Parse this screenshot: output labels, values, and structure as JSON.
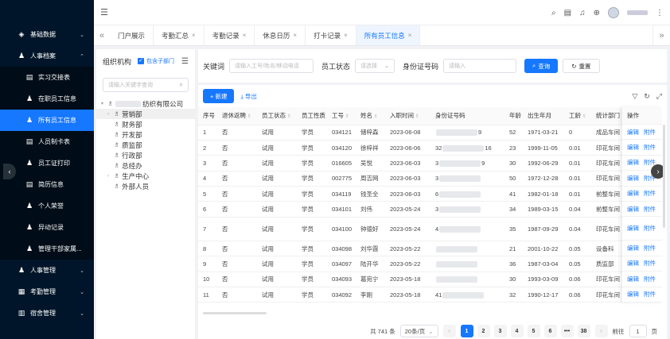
{
  "sidebar": {
    "items": [
      {
        "label": "基础数据",
        "icon": "layers-icon",
        "type": "group"
      },
      {
        "label": "人事档案",
        "icon": "user-icon",
        "type": "group-open"
      },
      {
        "label": "实习交接表",
        "icon": "doc-icon",
        "type": "sub"
      },
      {
        "label": "在职员工信息",
        "icon": "user-icon",
        "type": "sub"
      },
      {
        "label": "所有员工信息",
        "icon": "user-icon",
        "type": "sub-active"
      },
      {
        "label": "人员制卡表",
        "icon": "doc-icon",
        "type": "sub"
      },
      {
        "label": "员工证打印",
        "icon": "user-icon",
        "type": "sub"
      },
      {
        "label": "简历信息",
        "icon": "doc-icon",
        "type": "sub"
      },
      {
        "label": "个人荣誉",
        "icon": "user-icon",
        "type": "sub"
      },
      {
        "label": "异动记录",
        "icon": "user-icon",
        "type": "sub"
      },
      {
        "label": "管理干部家属...",
        "icon": "user-icon",
        "type": "sub"
      },
      {
        "label": "人事管理",
        "icon": "user-icon",
        "type": "group"
      },
      {
        "label": "考勤管理",
        "icon": "calendar-icon",
        "type": "group"
      },
      {
        "label": "宿舍管理",
        "icon": "building-icon",
        "type": "group"
      }
    ]
  },
  "tabs": [
    {
      "label": "门户展示",
      "close": false,
      "active": false
    },
    {
      "label": "考勤汇总",
      "close": true,
      "active": false
    },
    {
      "label": "考勤记录",
      "close": true,
      "active": false
    },
    {
      "label": "休息日历",
      "close": true,
      "active": false
    },
    {
      "label": "打卡记录",
      "close": true,
      "active": false
    },
    {
      "label": "所有员工信息",
      "close": true,
      "active": true
    }
  ],
  "org": {
    "title": "组织机构",
    "include_sub": "包含子部门",
    "search_placeholder": "请输入关键字查询",
    "root_suffix": "纺织有限公司",
    "nodes": [
      {
        "label": "营销部",
        "arrow": true,
        "selected": true
      },
      {
        "label": "财务部",
        "arrow": false
      },
      {
        "label": "开发部",
        "arrow": false
      },
      {
        "label": "质监部",
        "arrow": false
      },
      {
        "label": "行政部",
        "arrow": false
      },
      {
        "label": "总经办",
        "arrow": false
      },
      {
        "label": "生产中心",
        "arrow": true
      },
      {
        "label": "外部人员",
        "arrow": false
      }
    ]
  },
  "filters": {
    "keyword_label": "关键词",
    "keyword_placeholder": "请输入工号/姓名/移动电话",
    "status_label": "员工状态",
    "status_placeholder": "请选择",
    "id_label": "身份证号码",
    "id_placeholder": "请输入",
    "search_btn": "查询",
    "reset_btn": "重置"
  },
  "toolbar": {
    "add": "+ 新建",
    "export": "导出"
  },
  "table": {
    "headers": [
      "序号",
      "退休返聘",
      "员工状态",
      "员工性质",
      "工号",
      "姓名",
      "入职时间",
      "身份证号码",
      "年龄",
      "出生年月",
      "工龄",
      "统计部门"
    ],
    "ops_header": "操作",
    "op_edit": "编辑",
    "op_attach": "附件",
    "rows": [
      {
        "no": "1",
        "retire": "否",
        "status": "试用",
        "nature": "学员",
        "id": "034121",
        "name": "储梓森",
        "date": "2023-06-08",
        "idno_a": "",
        "idno_b": "9",
        "age": "52",
        "birth": "1971-03-21",
        "seniority": "0",
        "dept": "成品车间",
        "tall": false
      },
      {
        "no": "2",
        "retire": "否",
        "status": "试用",
        "nature": "学员",
        "id": "034120",
        "name": "徐梓祥",
        "date": "2023-06-06",
        "idno_a": "32",
        "idno_b": "16",
        "age": "23",
        "birth": "1999-11-05",
        "seniority": "0.01",
        "dept": "印花车间",
        "tall": false
      },
      {
        "no": "3",
        "retire": "否",
        "status": "试用",
        "nature": "学员",
        "id": "016605",
        "name": "吴悦",
        "date": "2023-06-03",
        "idno_a": "3",
        "idno_b": "9",
        "age": "30",
        "birth": "1992-06-29",
        "seniority": "0.01",
        "dept": "印花车间",
        "tall": false
      },
      {
        "no": "4",
        "retire": "否",
        "status": "试用",
        "nature": "学员",
        "id": "002775",
        "name": "周吉网",
        "date": "2023-06-03",
        "idno_a": "3",
        "idno_b": "",
        "age": "50",
        "birth": "1972-12-28",
        "seniority": "0.01",
        "dept": "印花车间",
        "tall": false
      },
      {
        "no": "5",
        "retire": "否",
        "status": "试用",
        "nature": "学员",
        "id": "034119",
        "name": "钱圣全",
        "date": "2023-06-03",
        "idno_a": "6",
        "idno_b": "",
        "age": "41",
        "birth": "1982-01-18",
        "seniority": "0.01",
        "dept": "前整车间",
        "tall": false
      },
      {
        "no": "6",
        "retire": "否",
        "status": "试用",
        "nature": "学员",
        "id": "034101",
        "name": "刘伟",
        "date": "2023-05-24",
        "idno_a": "3",
        "idno_b": "",
        "age": "34",
        "birth": "1989-03-15",
        "seniority": "0.04",
        "dept": "前整车间",
        "tall": false
      },
      {
        "no": "7",
        "retire": "否",
        "status": "试用",
        "nature": "学员",
        "id": "034100",
        "name": "钟德好",
        "date": "2023-05-24",
        "idno_a": "4",
        "idno_b": "",
        "age": "35",
        "birth": "1987-09-29",
        "seniority": "0.04",
        "dept": "印花车间",
        "tall": true
      },
      {
        "no": "8",
        "retire": "否",
        "status": "试用",
        "nature": "学员",
        "id": "034098",
        "name": "刘华霞",
        "date": "2023-05-22",
        "idno_a": "",
        "idno_b": "",
        "age": "21",
        "birth": "2001-10-22",
        "seniority": "0.05",
        "dept": "设备科",
        "tall": false
      },
      {
        "no": "9",
        "retire": "否",
        "status": "试用",
        "nature": "学员",
        "id": "034097",
        "name": "陆开华",
        "date": "2023-05-22",
        "idno_a": "",
        "idno_b": "",
        "age": "36",
        "birth": "1987-03-04",
        "seniority": "0.05",
        "dept": "质监部",
        "tall": false
      },
      {
        "no": "10",
        "retire": "否",
        "status": "试用",
        "nature": "学员",
        "id": "034093",
        "name": "葛宛宁",
        "date": "2023-05-18",
        "idno_a": "",
        "idno_b": "",
        "age": "30",
        "birth": "1993-03-09",
        "seniority": "0.06",
        "dept": "印花车间",
        "tall": false
      },
      {
        "no": "11",
        "retire": "否",
        "status": "试用",
        "nature": "学员",
        "id": "034092",
        "name": "李刚",
        "date": "2023-05-18",
        "idno_a": "41",
        "idno_b": "",
        "age": "32",
        "birth": "1990-12-17",
        "seniority": "0.06",
        "dept": "印花车间",
        "tall": false
      }
    ]
  },
  "pager": {
    "total": "共 741 条",
    "size": "20条/页",
    "pages": [
      "1",
      "2",
      "3",
      "4",
      "5",
      "6",
      "•••",
      "38"
    ],
    "goto": "前往",
    "goto_value": "1",
    "page_suffix": "页"
  },
  "colors": {
    "primary": "#1677ff",
    "sidebar": "#001529"
  }
}
